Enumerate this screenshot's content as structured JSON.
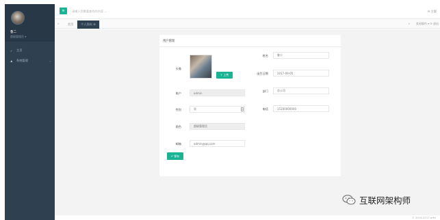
{
  "sidebar": {
    "user_name": "鲁二",
    "user_role": "超级管理员 ▾",
    "items": [
      {
        "icon": "check-icon",
        "glyph": "✓",
        "label": "主页"
      },
      {
        "icon": "user-icon",
        "glyph": "♟",
        "label": "系统管理",
        "arrow": "‹"
      }
    ]
  },
  "topbar": {
    "search_placeholder": "请输入您需要查找的内容 ...",
    "right_text": "⊟ 主题"
  },
  "tabs": {
    "prev": "«",
    "items": [
      {
        "label": "首页"
      },
      {
        "label": "个人资料 ⊗",
        "active": true
      }
    ],
    "next": "»",
    "close_all": "关闭操作 ▾",
    "refresh": "⟳ 退出"
  },
  "panel": {
    "title": "用户管理",
    "upload_label": "⇪ 上传",
    "save_label": "✔ 保存",
    "fields": {
      "avatar": {
        "label": "头像"
      },
      "account": {
        "label": "账户",
        "value": "admin"
      },
      "gender": {
        "label": "性别",
        "value": "男"
      },
      "role": {
        "label": "角色",
        "value": "超级管理员"
      },
      "email": {
        "label": "邮箱",
        "value": "admin@qq.com"
      },
      "name": {
        "label": "姓名",
        "value": "鲁二"
      },
      "birthday": {
        "label": "出生日期",
        "value": "2017-09-05"
      },
      "department": {
        "label": "部门",
        "value": "总公司"
      },
      "phone": {
        "label": "电话",
        "value": "15200000000"
      }
    }
  },
  "watermark": {
    "text": "互联网架构师"
  },
  "footer": {
    "text": "© 2016-2017 ares"
  },
  "colors": {
    "accent": "#1ab394",
    "sidebar": "#2f4050",
    "content_bg": "#f3f3f4"
  }
}
